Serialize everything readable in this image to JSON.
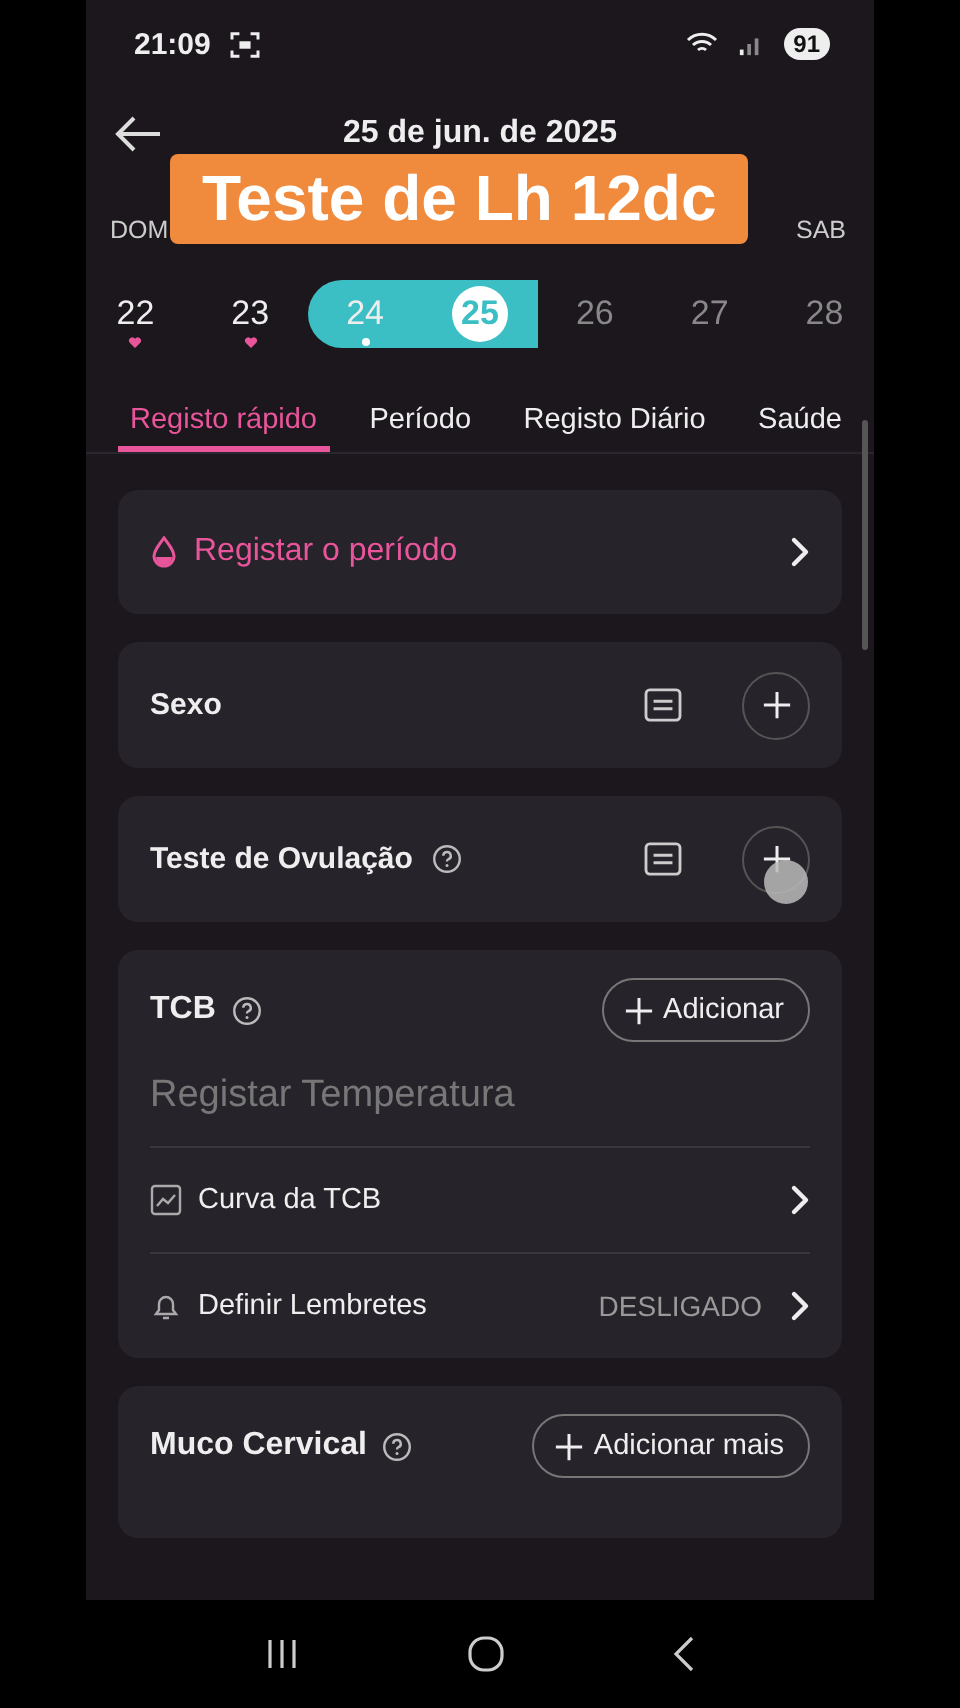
{
  "status_bar": {
    "time": "21:09",
    "battery": "91"
  },
  "header": {
    "title": "25 de jun. de 2025"
  },
  "caption": "Teste de Lh 12dc",
  "weekdays": [
    "DOM",
    "SAB"
  ],
  "days": [
    {
      "label": "22",
      "period_logged": true,
      "note_logged": false,
      "in_range": false,
      "selected": false,
      "future": false
    },
    {
      "label": "23",
      "period_logged": true,
      "note_logged": false,
      "in_range": false,
      "selected": false,
      "future": false
    },
    {
      "label": "24",
      "period_logged": false,
      "note_logged": true,
      "in_range": true,
      "selected": false,
      "future": false
    },
    {
      "label": "25",
      "period_logged": false,
      "note_logged": false,
      "in_range": true,
      "selected": true,
      "future": false
    },
    {
      "label": "26",
      "period_logged": false,
      "note_logged": false,
      "in_range": false,
      "selected": false,
      "future": true
    },
    {
      "label": "27",
      "period_logged": false,
      "note_logged": false,
      "in_range": false,
      "selected": false,
      "future": true
    },
    {
      "label": "28",
      "period_logged": false,
      "note_logged": false,
      "in_range": false,
      "selected": false,
      "future": true
    }
  ],
  "tabs": [
    {
      "label": "Registo rápido",
      "selected": true
    },
    {
      "label": "Período",
      "selected": false
    },
    {
      "label": "Registo Diário",
      "selected": false
    },
    {
      "label": "Saúde",
      "selected": false
    }
  ],
  "cards": [
    {
      "kind": "link",
      "label": "Registar o período"
    },
    {
      "kind": "entry",
      "label": "Sexo",
      "help": false
    },
    {
      "kind": "entry",
      "label": "Teste de Ovulação",
      "help": true
    },
    {
      "kind": "tcb",
      "label": "TCB",
      "help": true,
      "button": "Adicionar",
      "placeholder": "Registar Temperatura",
      "rows": [
        {
          "kind": "chart",
          "label": "Curva da TCB"
        },
        {
          "kind": "reminder",
          "label": "Definir Lembretes",
          "value": "DESLIGADO"
        }
      ]
    },
    {
      "kind": "section",
      "label": "Muco Cervical",
      "help": true,
      "button": "Adicionar mais"
    }
  ]
}
